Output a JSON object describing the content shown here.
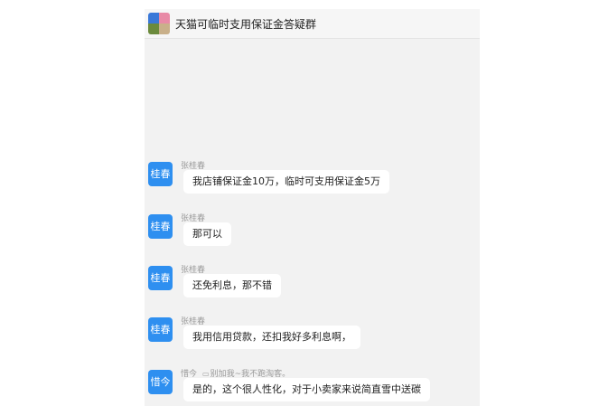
{
  "header": {
    "title": "天猫可临时支用保证金答疑群",
    "avatar_colors": [
      "#3a78d8",
      "#e88aa6",
      "#6b8a3c",
      "#c9b08a"
    ]
  },
  "colors": {
    "avatar_bg": "#2e8ff0",
    "chat_bg": "#f2f2f2",
    "bubble_bg": "#ffffff"
  },
  "messages": [
    {
      "avatar_text": "桂春",
      "sender": "张桂春",
      "text": "我店铺保证金10万，临时可支用保证金5万"
    },
    {
      "avatar_text": "桂春",
      "sender": "张桂春",
      "text": "那可以"
    },
    {
      "avatar_text": "桂春",
      "sender": "张桂春",
      "text": "还免利息，那不错"
    },
    {
      "avatar_text": "桂春",
      "sender": "张桂春",
      "text": "我用信用贷款，还扣我好多利息啊，"
    },
    {
      "avatar_text": "惜今",
      "sender": "惜今",
      "signature": "别加我~我不跑淘客。",
      "text": "是的，这个很人性化，对于小卖家来说简直雪中送碳"
    }
  ]
}
